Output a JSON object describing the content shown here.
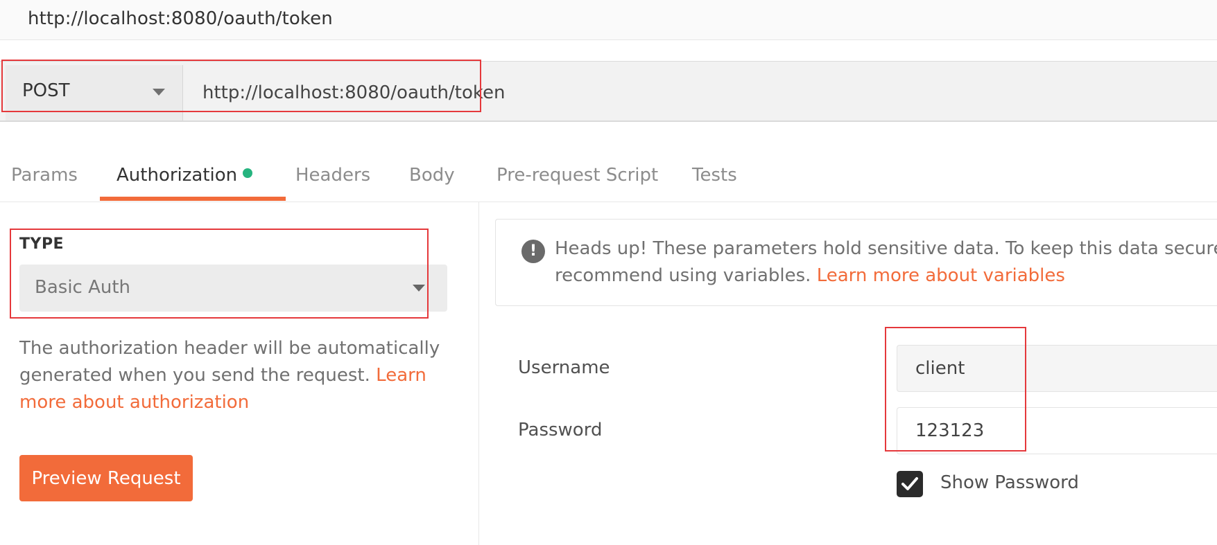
{
  "window": {
    "title": "http://localhost:8080/oauth/token"
  },
  "request": {
    "method": "POST",
    "url": "http://localhost:8080/oauth/token"
  },
  "tabs": [
    {
      "label": "Params"
    },
    {
      "label": "Authorization",
      "active": true,
      "indicator": "green-dot"
    },
    {
      "label": "Headers"
    },
    {
      "label": "Body"
    },
    {
      "label": "Pre-request Script"
    },
    {
      "label": "Tests"
    }
  ],
  "auth": {
    "type_label": "TYPE",
    "type_value": "Basic Auth",
    "description": "The authorization header will be automatically generated when you send the request. ",
    "description_link": "Learn more about authorization",
    "preview_button": "Preview Request"
  },
  "alert": {
    "icon": "info-icon",
    "text": "Heads up! These parameters hold sensitive data. To keep this data secure while working in a collaborative environment, we",
    "text_line2": "recommend using variables. ",
    "link": "Learn more about variables"
  },
  "credentials": {
    "username_label": "Username",
    "username_value": "client",
    "password_label": "Password",
    "password_value": "123123",
    "show_password_label": "Show Password",
    "show_password_checked": true
  },
  "colors": {
    "accent": "#f26b3a",
    "active_dot": "#26b47f",
    "highlight": "#e5383b"
  }
}
